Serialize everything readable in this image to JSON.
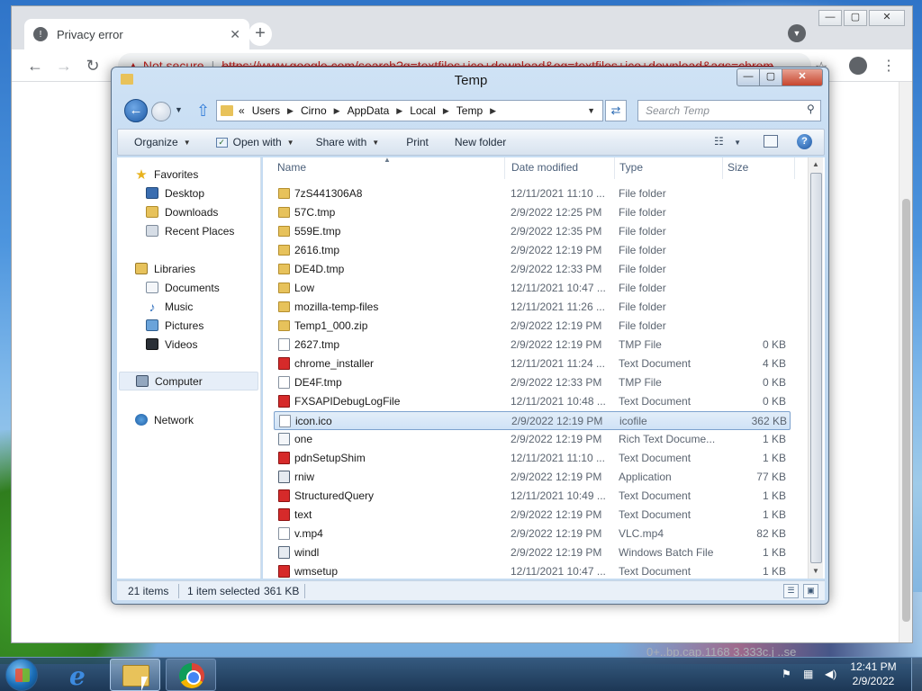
{
  "chrome": {
    "tab_title": "Privacy error",
    "tab_close": "✕",
    "new_tab": "+",
    "win_min": "▭",
    "win_max": "▢",
    "win_close": "✕",
    "back": "←",
    "forward": "→",
    "reload": "↻",
    "warning": "▲",
    "not_secure": "Not secure",
    "separator": "|",
    "url": "https://www.google.com/search?q=textfiles+ico+download&oq=textfiles+ico+download&aqs=chrom",
    "star": "☆",
    "menu": "⋮",
    "behind_text": "0+..bp.cap.1168      3.333c.j      ..se"
  },
  "explorer": {
    "title": "Temp",
    "controls": {
      "minimize": "—",
      "maximize": "▢",
      "close": "✕"
    },
    "back": "←",
    "up": "⇧",
    "refresh": "⇄",
    "breadcrumb_prefix": "«",
    "breadcrumb": [
      "Users",
      "Cirno",
      "AppData",
      "Local",
      "Temp"
    ],
    "search_placeholder": "Search Temp",
    "search_glyph": "⚲",
    "commands": {
      "organize": "Organize",
      "open_with": "Open with",
      "share_with": "Share with",
      "print": "Print",
      "new_folder": "New folder"
    },
    "help": "?",
    "nav": {
      "favorites": "Favorites",
      "desktop": "Desktop",
      "downloads": "Downloads",
      "recent": "Recent Places",
      "libraries": "Libraries",
      "documents": "Documents",
      "music": "Music",
      "pictures": "Pictures",
      "videos": "Videos",
      "computer": "Computer",
      "network": "Network"
    },
    "columns": {
      "name": "Name",
      "date": "Date modified",
      "type": "Type",
      "size": "Size"
    },
    "files": [
      {
        "name": "7zS441306A8",
        "date": "12/11/2021 11:10 ...",
        "type": "File folder",
        "size": "",
        "icon": "folder-icon"
      },
      {
        "name": "57C.tmp",
        "date": "2/9/2022 12:25 PM",
        "type": "File folder",
        "size": "",
        "icon": "folder-icon"
      },
      {
        "name": "559E.tmp",
        "date": "2/9/2022 12:35 PM",
        "type": "File folder",
        "size": "",
        "icon": "folder-icon"
      },
      {
        "name": "2616.tmp",
        "date": "2/9/2022 12:19 PM",
        "type": "File folder",
        "size": "",
        "icon": "folder-icon"
      },
      {
        "name": "DE4D.tmp",
        "date": "2/9/2022 12:33 PM",
        "type": "File folder",
        "size": "",
        "icon": "folder-icon"
      },
      {
        "name": "Low",
        "date": "12/11/2021 10:47 ...",
        "type": "File folder",
        "size": "",
        "icon": "folder-icon"
      },
      {
        "name": "mozilla-temp-files",
        "date": "12/11/2021 11:26 ...",
        "type": "File folder",
        "size": "",
        "icon": "folder-icon"
      },
      {
        "name": "Temp1_000.zip",
        "date": "2/9/2022 12:19 PM",
        "type": "File folder",
        "size": "",
        "icon": "folder-icon"
      },
      {
        "name": "2627.tmp",
        "date": "2/9/2022 12:19 PM",
        "type": "TMP File",
        "size": "0 KB",
        "icon": "blank-file-icon"
      },
      {
        "name": "chrome_installer",
        "date": "12/11/2021 11:24 ...",
        "type": "Text Document",
        "size": "4 KB",
        "icon": "text-document-icon"
      },
      {
        "name": "DE4F.tmp",
        "date": "2/9/2022 12:33 PM",
        "type": "TMP File",
        "size": "0 KB",
        "icon": "blank-file-icon"
      },
      {
        "name": "FXSAPIDebugLogFile",
        "date": "12/11/2021 10:48 ...",
        "type": "Text Document",
        "size": "0 KB",
        "icon": "text-document-icon"
      },
      {
        "name": "icon.ico",
        "date": "2/9/2022 12:19 PM",
        "type": "icofile",
        "size": "362 KB",
        "icon": "blank-file-icon",
        "selected": true
      },
      {
        "name": "one",
        "date": "2/9/2022 12:19 PM",
        "type": "Rich Text Docume...",
        "size": "1 KB",
        "icon": "rich-text-icon"
      },
      {
        "name": "pdnSetupShim",
        "date": "12/11/2021 11:10 ...",
        "type": "Text Document",
        "size": "1 KB",
        "icon": "text-document-icon"
      },
      {
        "name": "rniw",
        "date": "2/9/2022 12:19 PM",
        "type": "Application",
        "size": "77 KB",
        "icon": "application-icon"
      },
      {
        "name": "StructuredQuery",
        "date": "12/11/2021 10:49 ...",
        "type": "Text Document",
        "size": "1 KB",
        "icon": "text-document-icon"
      },
      {
        "name": "text",
        "date": "2/9/2022 12:19 PM",
        "type": "Text Document",
        "size": "1 KB",
        "icon": "text-document-icon"
      },
      {
        "name": "v.mp4",
        "date": "2/9/2022 12:19 PM",
        "type": "VLC.mp4",
        "size": "82 KB",
        "icon": "blank-file-icon"
      },
      {
        "name": "windl",
        "date": "2/9/2022 12:19 PM",
        "type": "Windows Batch File",
        "size": "1 KB",
        "icon": "batch-file-icon"
      },
      {
        "name": "wmsetup",
        "date": "12/11/2021 10:47 ...",
        "type": "Text Document",
        "size": "1 KB",
        "icon": "text-document-icon"
      }
    ],
    "status": {
      "items": "21 items",
      "selected": "1 item selected",
      "size": "361 KB"
    }
  },
  "taskbar": {
    "time": "12:41 PM",
    "date": "2/9/2022"
  }
}
